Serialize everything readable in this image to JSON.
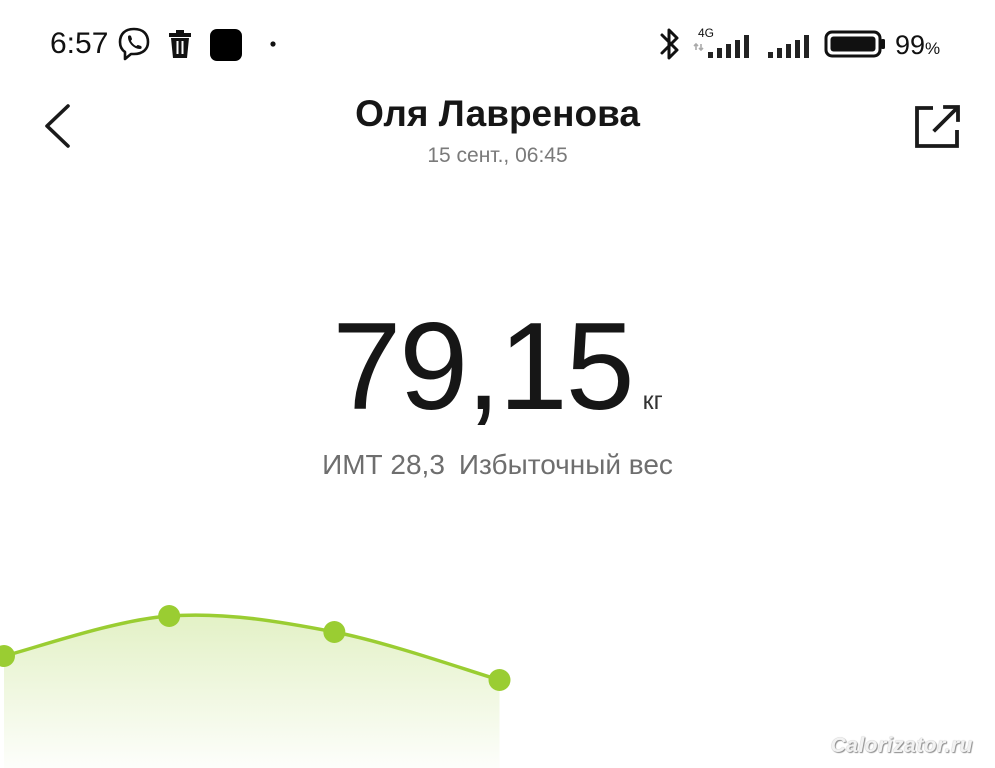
{
  "status_bar": {
    "time": "6:57",
    "network_label": "4G",
    "battery_percent": "99",
    "battery_percent_sign": "%",
    "icons": [
      "viber-icon",
      "trash-icon",
      "app-notification-icon",
      "dot-icon",
      "bluetooth-icon",
      "signal-4g-icon",
      "signal-icon",
      "battery-icon"
    ]
  },
  "header": {
    "title": "Оля Лавренова",
    "subtitle": "15 сент., 06:45",
    "back_icon": "chevron-left-icon",
    "share_icon": "share-external-icon"
  },
  "measurement": {
    "weight": "79,15",
    "unit": "кг",
    "bmi_label": "ИМТ 28,3",
    "bmi_status": "Избыточный вес"
  },
  "chart_data": {
    "type": "area",
    "title": "",
    "xlabel": "",
    "ylabel": "",
    "grid": false,
    "legend": "none",
    "line_color": "#9acd32",
    "point_color": "#9acd32",
    "fill_color": "#9acd32",
    "x": [
      0,
      1,
      2,
      3
    ],
    "series": [
      {
        "values": [
          79.3,
          79.55,
          79.45,
          79.15
        ]
      }
    ],
    "ylim": [
      78.6,
      79.9
    ],
    "xlim": [
      0,
      6
    ]
  },
  "watermark": "Calorizator.ru"
}
